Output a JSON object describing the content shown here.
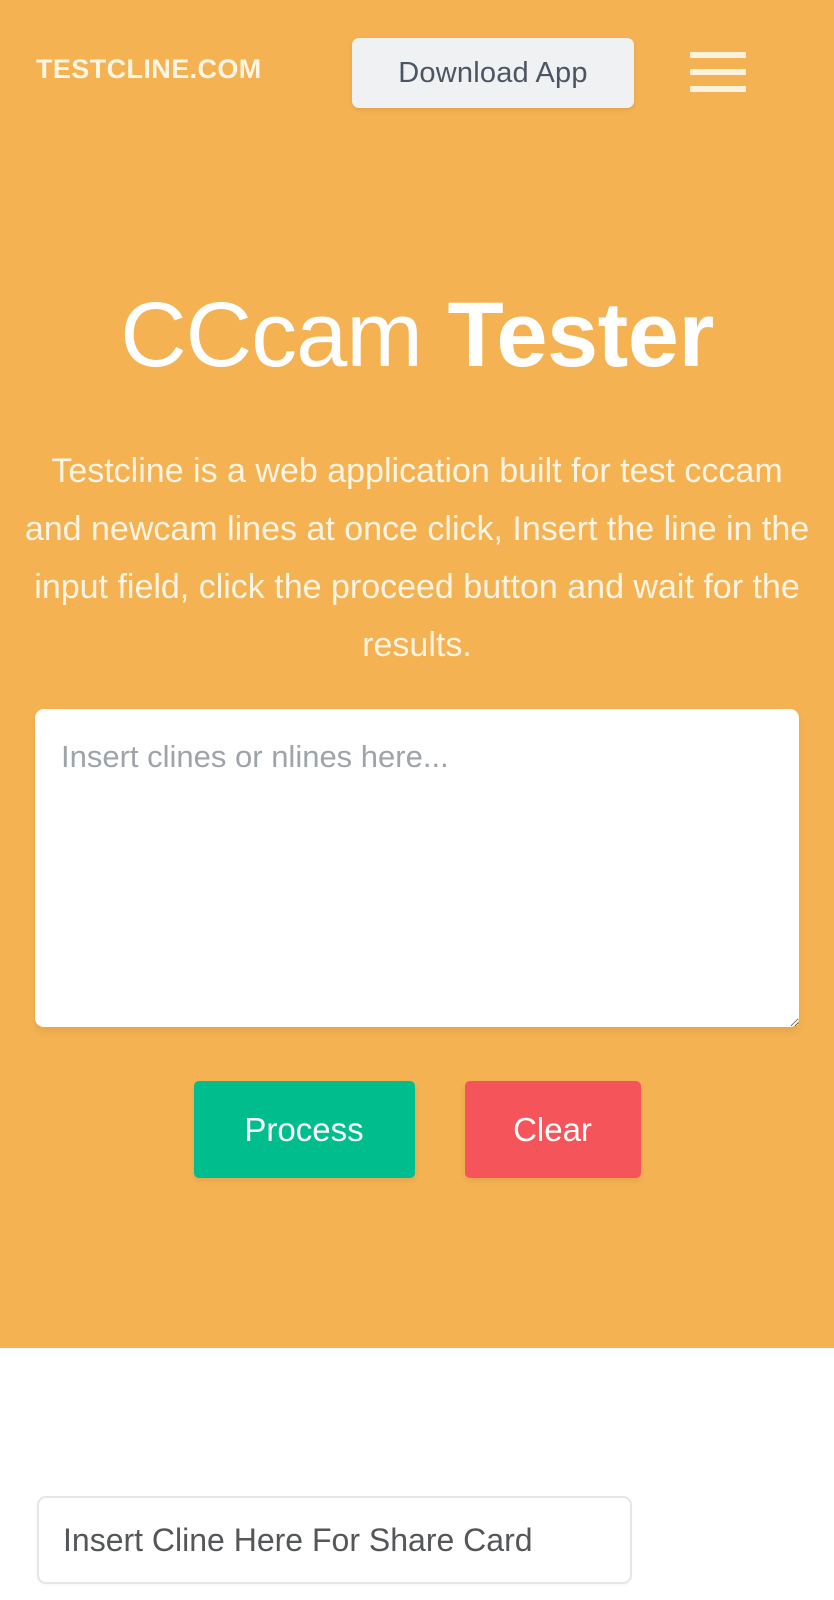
{
  "header": {
    "brand": "TESTCLINE.COM",
    "download_label": "Download App",
    "menu_icon": "hamburger-menu-icon"
  },
  "hero": {
    "title_light": "CCcam",
    "title_bold": "Tester",
    "description": "Testcline is a web application built for test cccam and newcam lines at once click, Insert the line in the input field, click the proceed button and wait for the results.",
    "textarea_placeholder": "Insert clines or nlines here...",
    "textarea_value": ""
  },
  "actions": {
    "process_label": "Process",
    "clear_label": "Clear"
  },
  "share": {
    "placeholder": "Insert Cline Here For Share Card",
    "value": ""
  },
  "colors": {
    "hero_background": "#f4b253",
    "brand_text": "#fdf6e4",
    "download_button_background": "#f0f1f3",
    "download_button_text": "#4c5563",
    "process_button": "#00bd8e",
    "clear_button": "#f5555a",
    "title_text": "#ffffff",
    "description_text": "#fdf4e3",
    "page_background": "#ffffff"
  }
}
